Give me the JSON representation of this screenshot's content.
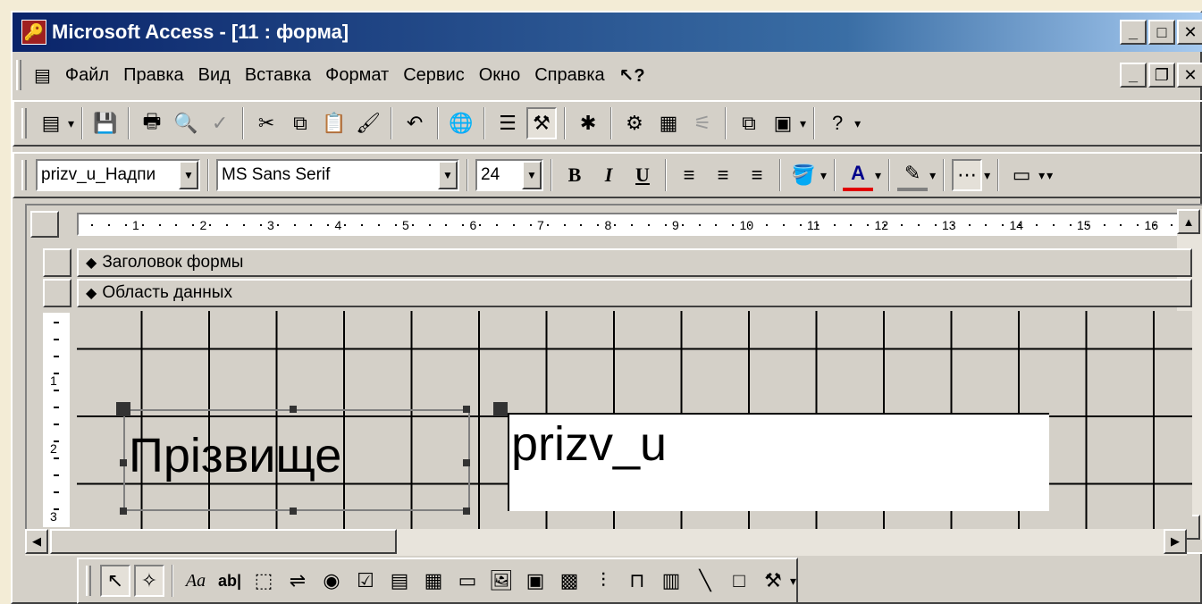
{
  "window": {
    "title": "Microsoft Access - [11 : форма]"
  },
  "menu": {
    "items": [
      {
        "label": "Файл"
      },
      {
        "label": "Правка"
      },
      {
        "label": "Вид"
      },
      {
        "label": "Вставка"
      },
      {
        "label": "Формат"
      },
      {
        "label": "Сервис"
      },
      {
        "label": "Окно"
      },
      {
        "label": "Справка"
      }
    ]
  },
  "formatting": {
    "object": "prizv_u_Надпи",
    "font": "MS Sans Serif",
    "size": "24",
    "bold": "B",
    "italic": "I",
    "underline": "U",
    "font_color_letter": "A"
  },
  "ruler_h": [
    "1",
    "2",
    "3",
    "4",
    "5",
    "6",
    "7",
    "8",
    "9",
    "10",
    "11",
    "12",
    "13",
    "14",
    "15",
    "16"
  ],
  "ruler_v": [
    "1",
    "2",
    "3"
  ],
  "sections": {
    "header": "Заголовок формы",
    "detail": "Область данных"
  },
  "controls": {
    "label_text": "Прізвище",
    "field_text": "prizv_u"
  },
  "toolbox": {
    "label_tool": "Aa",
    "textbox_tool": "ab|"
  },
  "colors": {
    "title_start": "#0a246a",
    "title_end": "#a6caf0",
    "face": "#d4d0c8",
    "font_color": "#e00000"
  }
}
